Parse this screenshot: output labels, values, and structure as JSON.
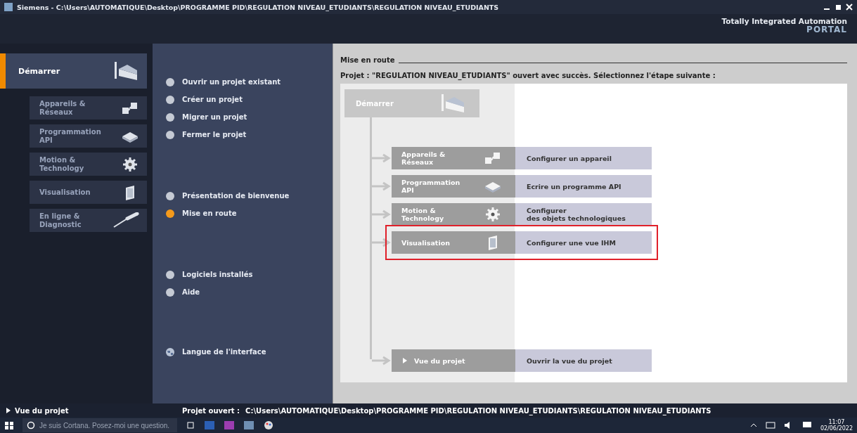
{
  "title_bar": {
    "title": "Siemens  -  C:\\Users\\AUTOMATIQUE\\Desktop\\PROGRAMME PID\\REGULATION NIVEAU_ETUDIANTS\\REGULATION NIVEAU_ETUDIANTS"
  },
  "header": {
    "brand": "Totally Integrated Automation",
    "product": "PORTAL"
  },
  "nav": {
    "items": [
      {
        "label": "Démarrer",
        "kind": "portal",
        "selected": true
      },
      {
        "label": "Appareils &\nRéseaux",
        "kind": "devices",
        "selected": false
      },
      {
        "label": "Programmation\nAPI",
        "kind": "plc",
        "selected": false
      },
      {
        "label": "Motion &\nTechnology",
        "kind": "gear",
        "selected": false
      },
      {
        "label": "Visualisation",
        "kind": "panel",
        "selected": false
      },
      {
        "label": "En ligne &\nDiagnostic",
        "kind": "probe",
        "selected": false
      }
    ]
  },
  "action_groups": [
    [
      {
        "label": "Ouvrir un projet existant",
        "kind": "bullet",
        "selected": false
      },
      {
        "label": "Créer un projet",
        "kind": "bullet",
        "selected": false
      },
      {
        "label": "Migrer un projet",
        "kind": "bullet",
        "selected": false
      },
      {
        "label": "Fermer le projet",
        "kind": "bullet",
        "selected": false
      }
    ],
    [
      {
        "label": "Présentation de bienvenue",
        "kind": "bullet",
        "selected": false
      },
      {
        "label": "Mise en route",
        "kind": "bullet",
        "selected": true
      }
    ],
    [
      {
        "label": "Logiciels installés",
        "kind": "bullet",
        "selected": false
      },
      {
        "label": "Aide",
        "kind": "bullet",
        "selected": false
      }
    ],
    [
      {
        "label": "Langue de l'interface",
        "kind": "globe",
        "selected": false
      }
    ]
  ],
  "main": {
    "heading": "Mise en route",
    "message": "Projet : \"REGULATION NIVEAU_ETUDIANTS\" ouvert avec succès. Sélectionnez l'étape suivante :",
    "start": {
      "label": "Démarrer"
    },
    "steps": [
      {
        "label": "Appareils &\nRéseaux",
        "kind": "devices",
        "action": "Configurer un appareil",
        "highlighted": false
      },
      {
        "label": "Programmation\nAPI",
        "kind": "plc",
        "action": "Ecrire un programme API",
        "highlighted": false
      },
      {
        "label": "Motion &\nTechnology",
        "kind": "gear",
        "action": "Configurer\ndes objets technologiques",
        "highlighted": false
      },
      {
        "label": "Visualisation",
        "kind": "panel",
        "action": "Configurer une vue IHM",
        "highlighted": true
      }
    ],
    "project_view": {
      "label": "Vue du projet",
      "action": "Ouvrir la vue du projet"
    }
  },
  "status_bar": {
    "project_view": "Vue du projet",
    "label": "Projet ouvert :",
    "path": "C:\\Users\\AUTOMATIQUE\\Desktop\\PROGRAMME PID\\REGULATION NIVEAU_ETUDIANTS\\REGULATION NIVEAU_ETUDIANTS"
  },
  "taskbar": {
    "search_placeholder": "Je suis Cortana. Posez-moi une question.",
    "time": "11:07",
    "date": "02/06/2022"
  }
}
